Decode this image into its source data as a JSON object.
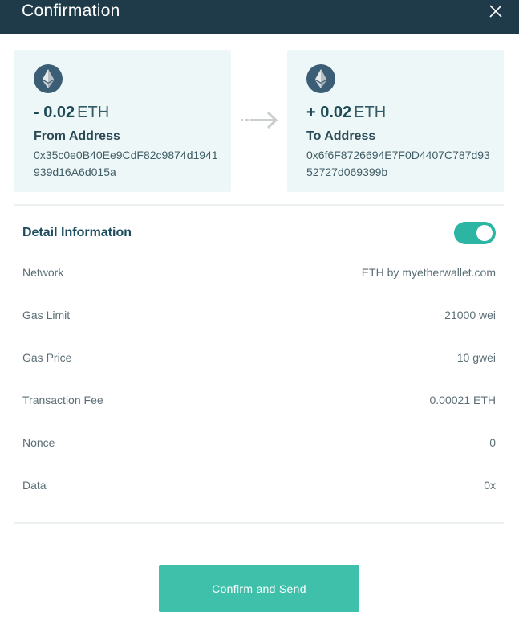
{
  "header": {
    "title": "Confirmation",
    "close_icon": "close-icon"
  },
  "from": {
    "icon": "ethereum-icon",
    "amount": "- 0.02",
    "unit": "ETH",
    "label": "From Address",
    "address": "0x35c0e0B40Ee9CdF82c9874d1941939d16A6d015a"
  },
  "to": {
    "icon": "ethereum-icon",
    "amount": "+ 0.02",
    "unit": "ETH",
    "label": "To Address",
    "address": "0x6f6F8726694E7F0D4407C787d9352727d069399b"
  },
  "detail": {
    "title": "Detail Information",
    "toggle_on": true,
    "rows": [
      {
        "label": "Network",
        "value": "ETH by myetherwallet.com"
      },
      {
        "label": "Gas Limit",
        "value": "21000 wei"
      },
      {
        "label": "Gas Price",
        "value": "10 gwei"
      },
      {
        "label": "Transaction Fee",
        "value": "0.00021 ETH"
      },
      {
        "label": "Nonce",
        "value": "0"
      },
      {
        "label": "Data",
        "value": "0x"
      }
    ]
  },
  "actions": {
    "confirm_label": "Confirm and Send"
  },
  "colors": {
    "header_bg": "#1f3b4a",
    "card_bg": "#eef7f7",
    "accent": "#3ec0ab",
    "toggle": "#2cb5a3"
  }
}
